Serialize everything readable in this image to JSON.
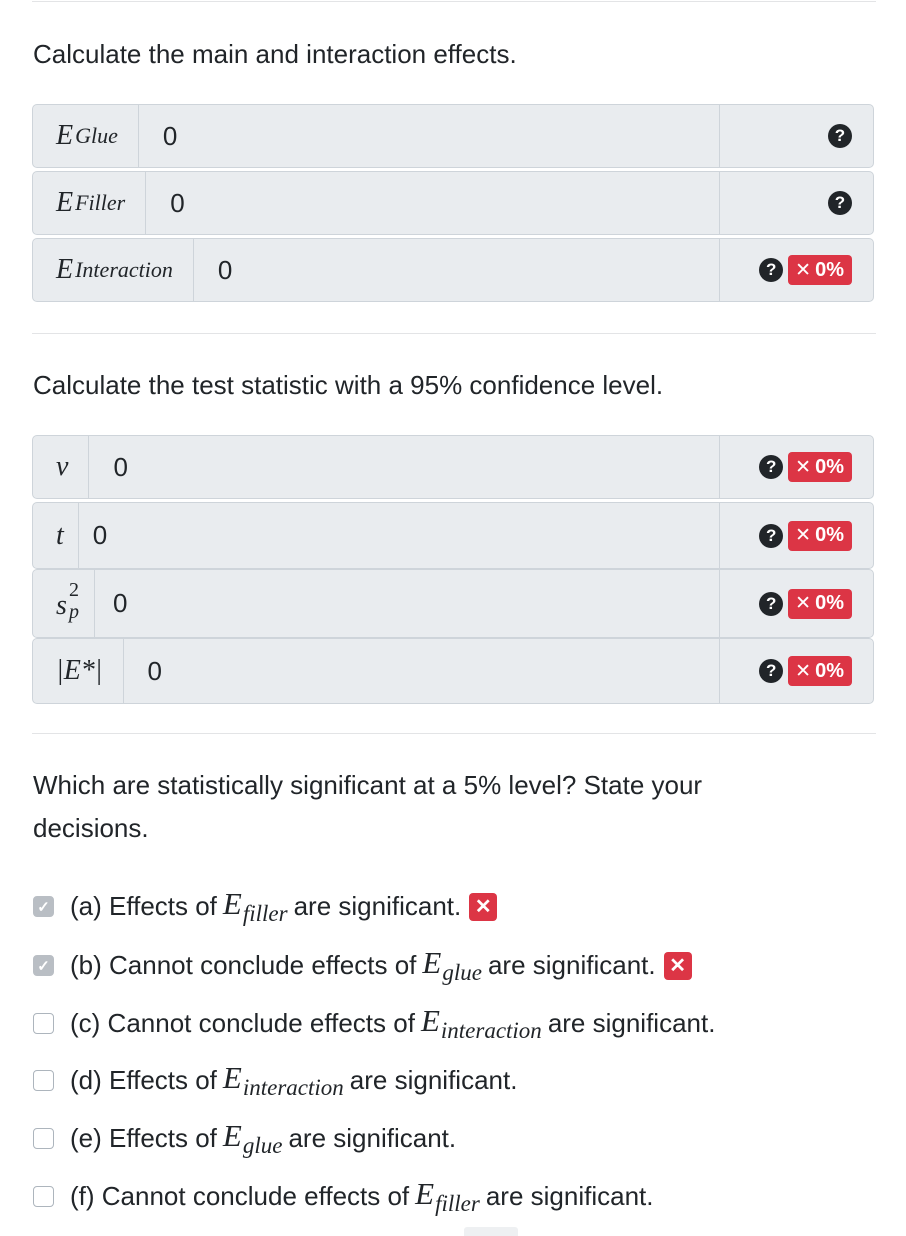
{
  "section1": {
    "prompt": "Calculate the main and interaction effects.",
    "rows": [
      {
        "symbol": "E",
        "sub": "Glue",
        "value": "0",
        "help": "?",
        "score": ""
      },
      {
        "symbol": "E",
        "sub": "Filler",
        "value": "0",
        "help": "?",
        "score": ""
      },
      {
        "symbol": "E",
        "sub": "Interaction",
        "value": "0",
        "help": "?",
        "score": "0%"
      }
    ]
  },
  "section2": {
    "prompt": "Calculate the test statistic with a 95% confidence level.",
    "rows": [
      {
        "symbol": "ν",
        "value": "0",
        "help": "?",
        "score": "0%"
      },
      {
        "symbol": "t",
        "value": "0",
        "help": "?",
        "score": "0%"
      },
      {
        "symbol": "s",
        "sup": "2",
        "sub": "p",
        "value": "0",
        "help": "?",
        "score": "0%"
      },
      {
        "symbol": "|E*|",
        "value": "0",
        "help": "?",
        "score": "0%"
      }
    ]
  },
  "section3": {
    "prompt_line1": "Which are statistically significant at a 5% level? State your",
    "prompt_line2": "decisions.",
    "options": [
      {
        "pre": "(a) Effects of",
        "sym": "E",
        "sub": "filler",
        "post": "are significant.",
        "checked": true,
        "marked_wrong": true
      },
      {
        "pre": "(b) Cannot conclude effects of",
        "sym": "E",
        "sub": "glue",
        "post": "are significant.",
        "checked": true,
        "marked_wrong": true
      },
      {
        "pre": "(c) Cannot conclude effects of",
        "sym": "E",
        "sub": "interaction",
        "post": "are significant.",
        "checked": false,
        "marked_wrong": false
      },
      {
        "pre": "(d) Effects of",
        "sym": "E",
        "sub": "interaction",
        "post": "are significant.",
        "checked": false,
        "marked_wrong": false
      },
      {
        "pre": "(e) Effects of",
        "sym": "E",
        "sub": "glue",
        "post": "are significant.",
        "checked": false,
        "marked_wrong": false
      },
      {
        "pre": "(f) Cannot conclude effects of",
        "sym": "E",
        "sub": "filler",
        "post": "are significant.",
        "checked": false,
        "marked_wrong": false
      }
    ],
    "check_glyph": "✓",
    "wrong_glyph": "✕"
  },
  "badge_x": "✕",
  "colors": {
    "danger": "#dc3545",
    "input_bg": "#e9ecef",
    "border": "#ced4da",
    "text": "#212529"
  }
}
